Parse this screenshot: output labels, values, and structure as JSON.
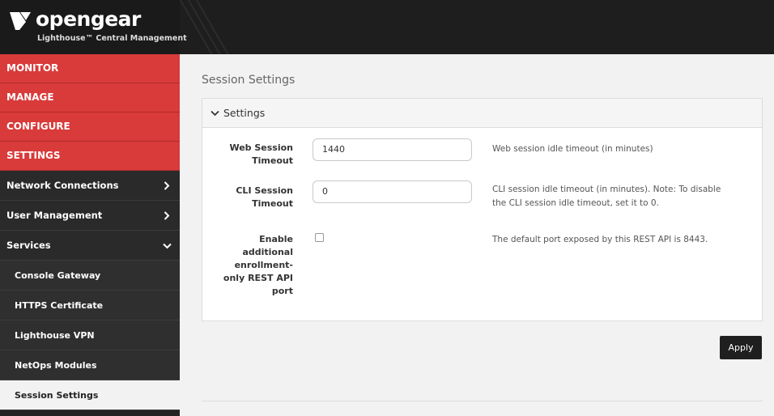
{
  "brand": {
    "name": "opengear",
    "subtitle": "Lighthouse™ Central Management"
  },
  "sidebar": {
    "top": [
      {
        "label": "MONITOR"
      },
      {
        "label": "MANAGE"
      },
      {
        "label": "CONFIGURE"
      },
      {
        "label": "SETTINGS"
      }
    ],
    "sections": [
      {
        "label": "Network Connections",
        "icon": "chevron-right-icon"
      },
      {
        "label": "User Management",
        "icon": "chevron-right-icon"
      },
      {
        "label": "Services",
        "icon": "chevron-down-icon"
      }
    ],
    "services_items": [
      {
        "label": "Console Gateway"
      },
      {
        "label": "HTTPS Certificate"
      },
      {
        "label": "Lighthouse VPN"
      },
      {
        "label": "NetOps Modules"
      },
      {
        "label": "Session Settings",
        "active": true
      }
    ]
  },
  "main": {
    "page_title": "Session Settings",
    "panel": {
      "title": "Settings",
      "fields": [
        {
          "label_line1": "Web Session",
          "label_line2": "Timeout",
          "value": "1440",
          "hint_line1": "Web session idle timeout (in minutes)",
          "hint_line2": ""
        },
        {
          "label_line1": "CLI Session",
          "label_line2": "Timeout",
          "value": "0",
          "hint_line1": "CLI session idle timeout (in minutes). Note: To disable",
          "hint_line2": "the CLI session idle timeout, set it to 0."
        }
      ],
      "rest_api": {
        "label_lines": [
          "Enable",
          "additional",
          "enrollment-",
          "only REST API",
          "port"
        ],
        "checked": false,
        "hint": "The default port exposed by this REST API is 8443."
      }
    },
    "apply_label": "Apply"
  },
  "colors": {
    "accent_red": "#d93a3a",
    "header_dark": "#1e1e1e",
    "sidebar_dark": "#2a2a2a"
  }
}
